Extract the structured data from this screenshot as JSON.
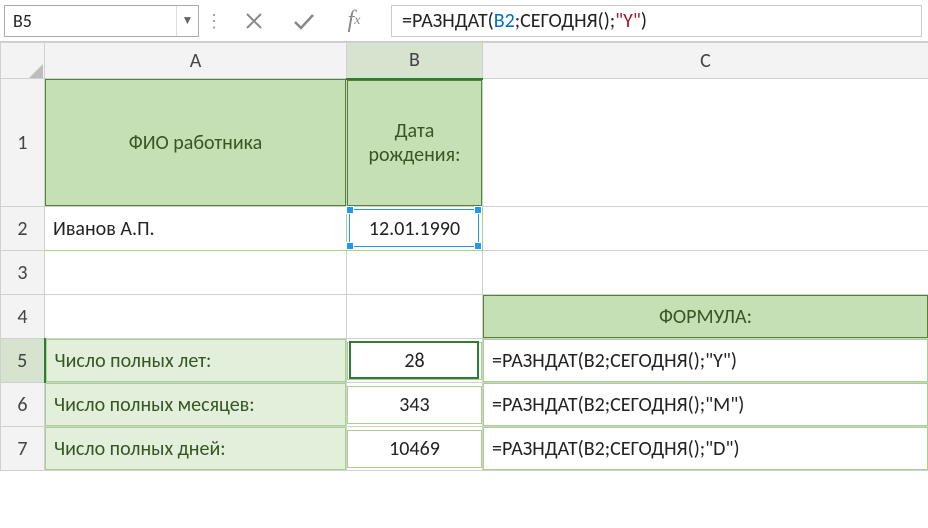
{
  "nameBox": "B5",
  "formulaTokens": {
    "pre": "=РАЗНДАТ(",
    "ref": "B2",
    "mid": ";СЕГОДНЯ();",
    "str": "\"Y\"",
    "post": ")"
  },
  "columns": [
    "A",
    "B",
    "C"
  ],
  "rows": [
    "1",
    "2",
    "3",
    "4",
    "5",
    "6",
    "7"
  ],
  "headers": {
    "a1": "ФИО работника",
    "b1": "Дата\nрождения:",
    "c4": "ФОРМУЛА:"
  },
  "cells": {
    "a2": "Иванов А.П.",
    "b2": "12.01.1990",
    "a5": "Число полных лет:",
    "b5": "28",
    "c5": "=РАЗНДАТ(B2;СЕГОДНЯ();\"Y\")",
    "a6": "Число полных месяцев:",
    "b6": "343",
    "c6": "=РАЗНДАТ(B2;СЕГОДНЯ();\"M\")",
    "a7": "Число полных дней:",
    "b7": "10469",
    "c7": "=РАЗНДАТ(B2;СЕГОДНЯ();\"D\")"
  },
  "colWidths": {
    "rowhdr": 44,
    "A": 302,
    "B": 136,
    "C": 446
  },
  "selection": {
    "cell": "B5"
  },
  "referencedCell": "B2"
}
